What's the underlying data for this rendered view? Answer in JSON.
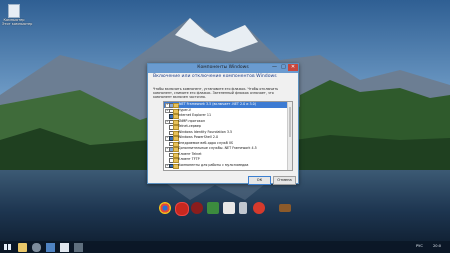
{
  "desktop": {
    "icon": {
      "label_line1": "Компьютер",
      "label_line2": "Этот компьютер"
    }
  },
  "dialog": {
    "title": "Компоненты Windows",
    "controls": {
      "minimize": "—",
      "maximize": "□",
      "close": "✕"
    },
    "heading": "Включение или отключение компонентов Windows",
    "description": "Чтобы включить компонент, установите его флажок. Чтобы отключить компонент, снимите его флажок. Затененный флажок означает, что компонент включен частично.",
    "items": [
      {
        "label": ".NET Framework 3.5 (включает .NET 2.0 и 3.0)",
        "expander": "+",
        "state": "partial",
        "selected": true
      },
      {
        "label": "Hyper-V",
        "expander": "+",
        "state": "off"
      },
      {
        "label": "Internet Explorer 11",
        "expander": "",
        "state": "on"
      },
      {
        "label": "SNMP-протокол",
        "expander": "+",
        "state": "off"
      },
      {
        "label": "Telnet-сервер",
        "expander": "",
        "state": "off"
      },
      {
        "label": "Windows Identity Foundation 3.5",
        "expander": "",
        "state": "off"
      },
      {
        "label": "Windows PowerShell 2.0",
        "expander": "+",
        "state": "on"
      },
      {
        "label": "Внедряемое веб-ядро служб IIS",
        "expander": "",
        "state": "off"
      },
      {
        "label": "Дополнительные службы .NET Framework 4.5",
        "expander": "+",
        "state": "partial"
      },
      {
        "label": "Клиент Telnet",
        "expander": "",
        "state": "off"
      },
      {
        "label": "Клиент TFTP",
        "expander": "",
        "state": "off"
      },
      {
        "label": "Компоненты для работы с мультимедиа",
        "expander": "+",
        "state": "on"
      }
    ],
    "ok_label": "ОК",
    "cancel_label": "Отмена"
  },
  "taskbar": {
    "language": "РУС",
    "time": "20:0",
    "icons": [
      "start-icon",
      "file-explorer-icon",
      "settings-icon",
      "app-icon",
      "app-icon",
      "app-icon"
    ]
  },
  "dock": {
    "apps": [
      "chrome-icon",
      "opera-icon",
      "red-round-app-icon",
      "system-monitor-icon",
      "terminal-icon",
      "usb-drive-icon",
      "download-manager-icon",
      "box-icon"
    ]
  },
  "colors": {
    "accent": "#6a9bd0",
    "selection": "#3d7bd3",
    "close": "#c7463c"
  }
}
